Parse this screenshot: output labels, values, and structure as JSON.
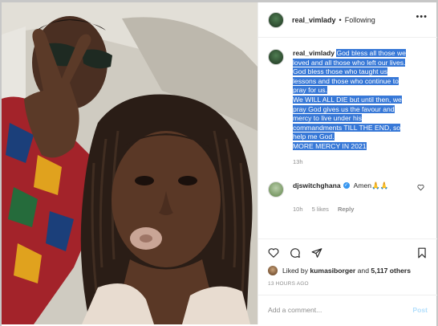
{
  "post": {
    "username": "real_vimlady",
    "dot": "•",
    "follow_status": "Following",
    "more_glyph": "•••",
    "caption_lines": [
      "God bless all those we",
      "loved and all those who left our lives.",
      "God bless those who taught us",
      "lessons and those who continue to",
      "pray for us.",
      "We WILL ALL DIE but until then, we",
      "pray God gives us the favour and",
      "mercy to live under his",
      "commandments TILL THE END, so",
      "help me God.",
      "MORE MERCY IN 2021"
    ],
    "caption_time": "13h"
  },
  "comment": {
    "username": "djswitchghana",
    "verified_glyph": "✓",
    "text": "Amen🙏🙏",
    "time": "10h",
    "likes": "5 likes",
    "reply": "Reply"
  },
  "actions": {
    "icons": [
      "heart-icon",
      "comment-icon",
      "share-icon",
      "bookmark-icon"
    ]
  },
  "likes": {
    "prefix": "Liked by ",
    "user": "kumasiborger",
    "mid": " and ",
    "count": "5,117 others"
  },
  "posted_ago": "13 HOURS AGO",
  "add_comment": {
    "placeholder": "Add a comment...",
    "post_label": "Post"
  },
  "colors": {
    "selection": "#3778d7",
    "post_disabled": "#b2dffc",
    "verified": "#3897f0"
  }
}
